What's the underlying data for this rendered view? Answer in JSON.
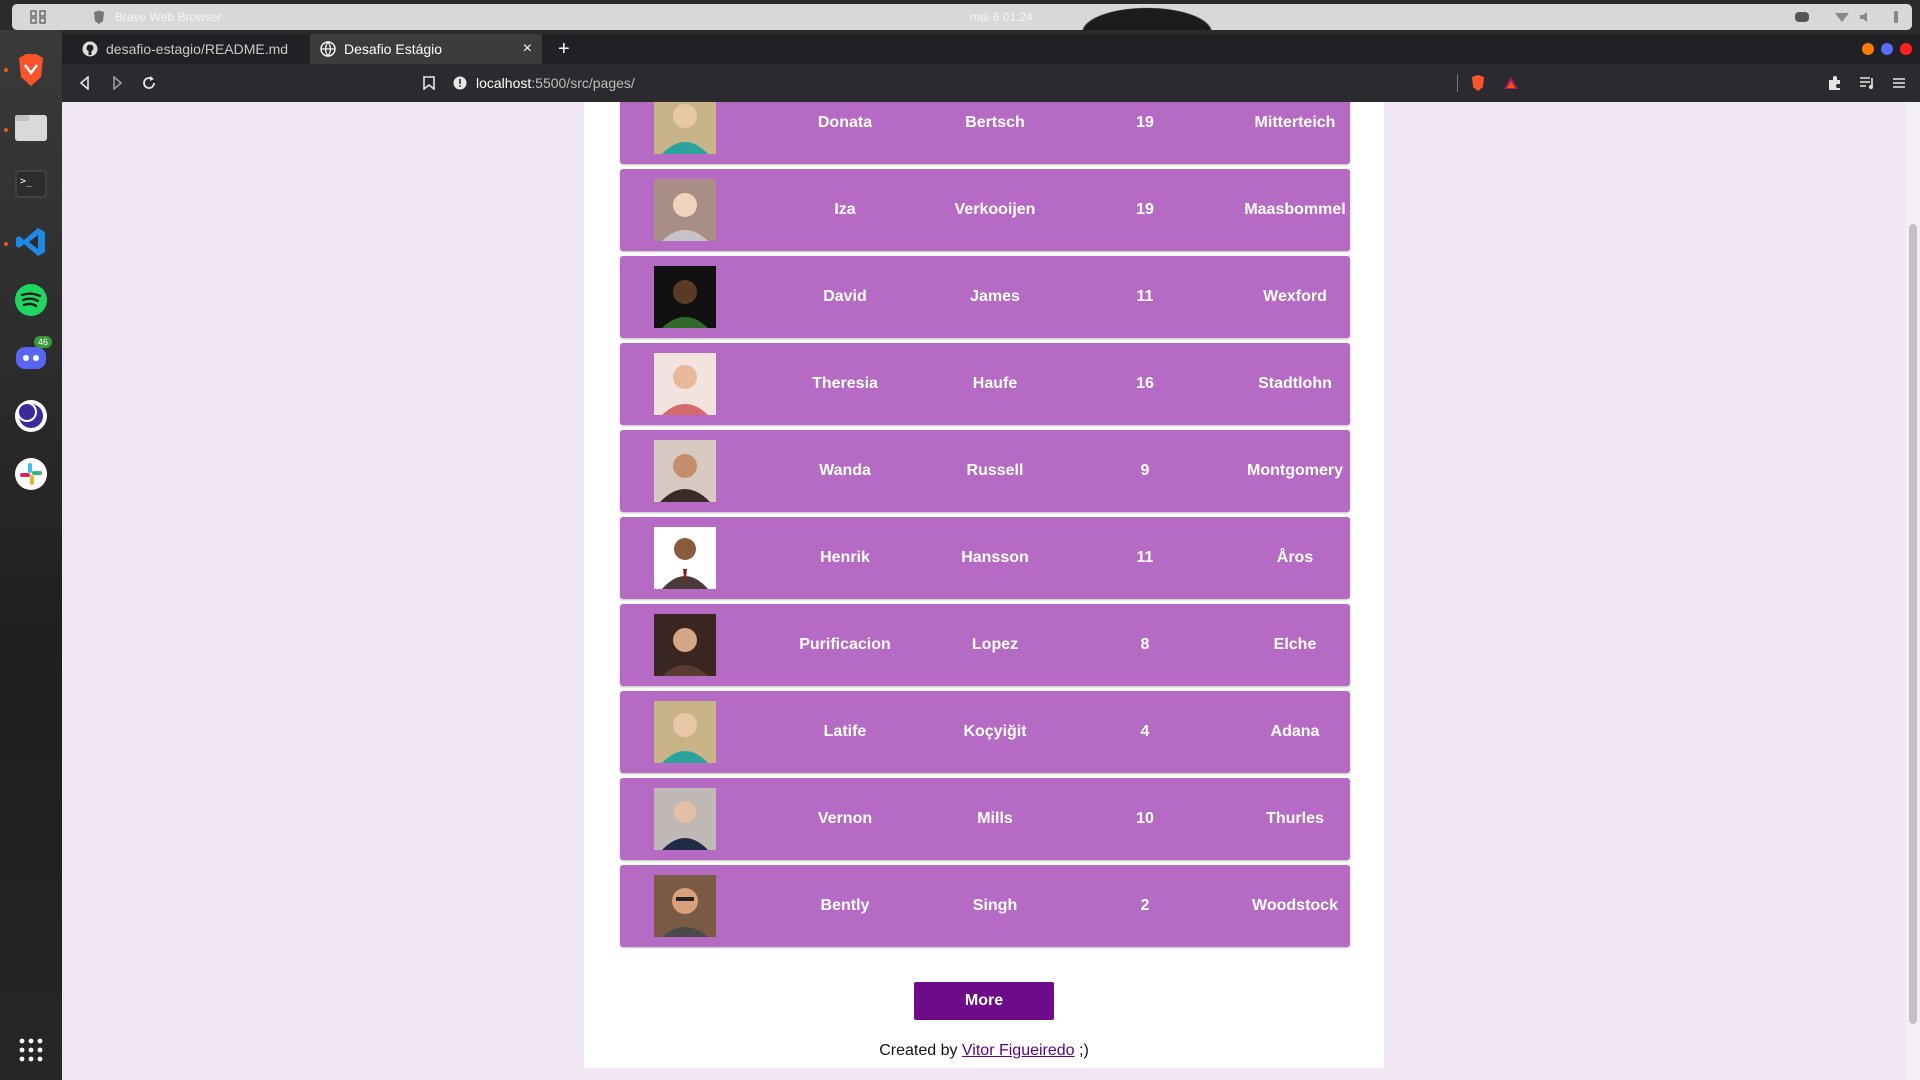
{
  "os": {
    "app_title": "Brave Web Browser",
    "clock": "mai 6  01:24"
  },
  "dock": {
    "discord_badge": "46"
  },
  "browser": {
    "tabs": [
      {
        "label": "desafio-estagio/README.md"
      },
      {
        "label": "Desafio Estágio"
      }
    ],
    "tab_close": "×",
    "new_tab": "+",
    "url_host": "localhost",
    "url_path": ":5500/src/pages/"
  },
  "page": {
    "rows": [
      {
        "first": "Donata",
        "last": "Bertsch",
        "age": "19",
        "city": "Mitterteich",
        "avatar_color": "#c9b48a"
      },
      {
        "first": "Iza",
        "last": "Verkooijen",
        "age": "19",
        "city": "Maasbommel",
        "avatar_color": "#a98e86"
      },
      {
        "first": "David",
        "last": "James",
        "age": "11",
        "city": "Wexford",
        "avatar_color": "#2f6a2a"
      },
      {
        "first": "Theresia",
        "last": "Haufe",
        "age": "16",
        "city": "Stadtlohn",
        "avatar_color": "#d46a6a"
      },
      {
        "first": "Wanda",
        "last": "Russell",
        "age": "9",
        "city": "Montgomery",
        "avatar_color": "#3a2a2a"
      },
      {
        "first": "Henrik",
        "last": "Hansson",
        "age": "11",
        "city": "Åros",
        "avatar_color": "#4a3a3a"
      },
      {
        "first": "Purificacion",
        "last": "Lopez",
        "age": "8",
        "city": "Elche",
        "avatar_color": "#5a3a32"
      },
      {
        "first": "Latife",
        "last": "Koçyiğit",
        "age": "4",
        "city": "Adana",
        "avatar_color": "#c9b48a"
      },
      {
        "first": "Vernon",
        "last": "Mills",
        "age": "10",
        "city": "Thurles",
        "avatar_color": "#bfb8b4"
      },
      {
        "first": "Bently",
        "last": "Singh",
        "age": "2",
        "city": "Woodstock",
        "avatar_color": "#7a5a44"
      }
    ],
    "more_label": "More",
    "footer_prefix": "Created by ",
    "footer_link": "Vitor Figueiredo",
    "footer_suffix": " ;)"
  }
}
